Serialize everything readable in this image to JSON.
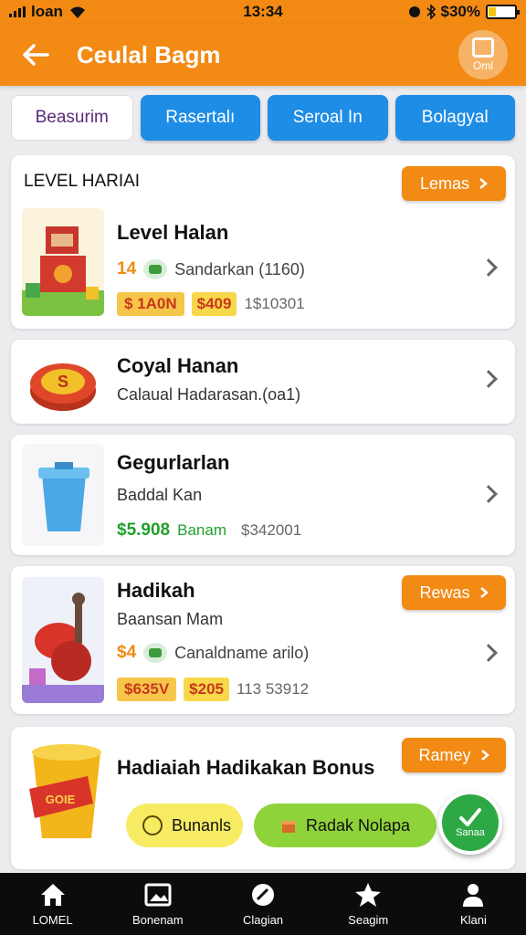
{
  "status": {
    "carrier": "loan",
    "time": "13:34",
    "battery_text": "$30%",
    "battery_level": 0.3
  },
  "app_bar": {
    "title": "Ceulal Bagm",
    "corner_label": "Oml"
  },
  "tabs": [
    {
      "label": "Beasurim",
      "active": true
    },
    {
      "label": "Rasertalı",
      "active": false
    },
    {
      "label": "Seroal In",
      "active": false
    },
    {
      "label": "Bolagyal",
      "active": false
    }
  ],
  "cards": {
    "level": {
      "header": "LEVEL HARIAI",
      "header_button": "Lemas",
      "title": "Level Halan",
      "count": "14",
      "sub": "Sandarkan (1160)",
      "price_tag": "$ 1A0N",
      "price_tag2": "$409",
      "muted": "1$10301"
    },
    "coin": {
      "title": "Coyal Hanan",
      "sub": "Calaual Hadarasan.(oa1)"
    },
    "bucket": {
      "title": "Gegurlarlan",
      "sub": "Baddal Kan",
      "green_price": "$5.908",
      "green_label": "Banam",
      "muted": "$342001"
    },
    "hadikah": {
      "title": "Hadikah",
      "header_button": "Rewas",
      "sub": "Baansan Mam",
      "count": "$4",
      "sub2": "Canaldname arilo)",
      "price_tag": "$635V",
      "price_tag2": "$205",
      "muted": "113 53912"
    },
    "bonus": {
      "title": "Hadiaiah Hadikakan Bonus",
      "header_button": "Ramey",
      "cup_text": "GOIE",
      "btn_yellow": "Bunanls",
      "btn_green": "Radak Nolapa",
      "fab_label": "Sanaa"
    }
  },
  "bottom_nav": [
    {
      "label": "LOMEL",
      "icon": "home-icon"
    },
    {
      "label": "Bonenam",
      "icon": "gallery-icon"
    },
    {
      "label": "Clagian",
      "icon": "tag-icon"
    },
    {
      "label": "Seagim",
      "icon": "star-icon"
    },
    {
      "label": "Klani",
      "icon": "user-icon"
    }
  ],
  "colors": {
    "accent_orange": "#f28a14",
    "tab_blue": "#1e8de6",
    "green": "#2ea845",
    "nav_bg": "#0c0c0c"
  }
}
